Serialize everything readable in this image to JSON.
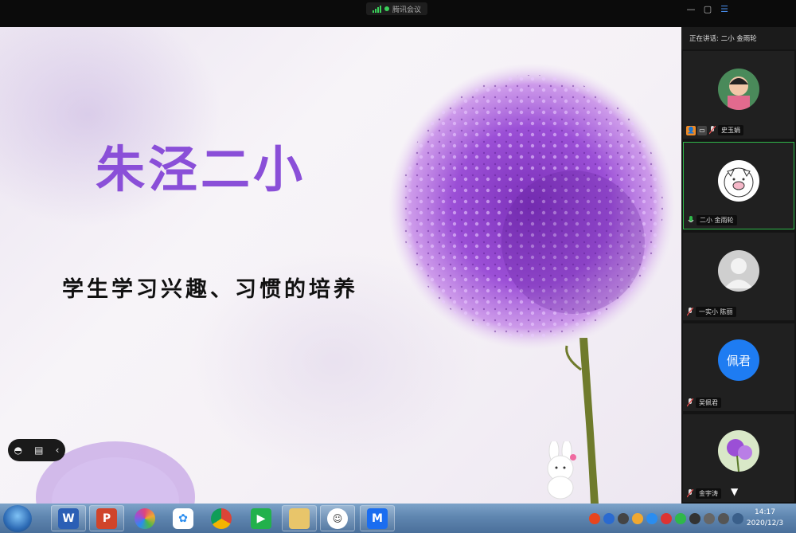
{
  "meeting": {
    "app_name": "腾讯会议"
  },
  "window_controls": [
    {
      "icon": "minimize-icon",
      "glyph": "—"
    },
    {
      "icon": "restore-icon",
      "glyph": "▢"
    },
    {
      "icon": "list-icon",
      "glyph": "☰"
    }
  ],
  "slide": {
    "title": "朱泾二小",
    "subtitle": "学生学习兴趣、习惯的培养",
    "title_color": "#8a4fd8"
  },
  "slide_tools": [
    {
      "icon": "annotation-icon",
      "glyph": "◓"
    },
    {
      "icon": "comment-icon",
      "glyph": "▤"
    },
    {
      "icon": "collapse-chevron-icon",
      "glyph": "‹"
    }
  ],
  "sidebar": {
    "speaking_label": "正在讲话: 二小 金雨轮",
    "participants": [
      {
        "name": "史玉娟",
        "avatar": "photo-child"
      },
      {
        "name": "二小 金雨轮",
        "avatar": "cartoon-pig",
        "active": true
      },
      {
        "name": "一实小 陈丽",
        "avatar": "default-person"
      },
      {
        "name": "吴佩君",
        "avatar": "initials",
        "initials": "佩君",
        "avatar_color": "#1e7cf2"
      },
      {
        "name": "金宇涛",
        "avatar": "photo-flower"
      }
    ]
  },
  "taskbar": {
    "apps": [
      {
        "icon": "word-icon",
        "label": "W",
        "color": "#2b5fb5"
      },
      {
        "icon": "powerpoint-icon",
        "label": "P",
        "color": "#d0442a"
      },
      {
        "icon": "color-wheel-icon",
        "label": "",
        "color": "#e0457b"
      },
      {
        "icon": "cloud-app-icon",
        "label": "",
        "color": "#2a8df0"
      },
      {
        "icon": "chrome-icon",
        "label": "",
        "color": "#e8b21e"
      },
      {
        "icon": "iqiyi-icon",
        "label": "",
        "color": "#22b14c"
      },
      {
        "icon": "folder-icon",
        "label": "",
        "color": "#e8c56a"
      },
      {
        "icon": "meeting-user-icon",
        "label": "",
        "color": "#ffffff"
      },
      {
        "icon": "tencent-meeting-icon",
        "label": "",
        "color": "#1a6df0"
      }
    ],
    "clock": {
      "time": "14:17",
      "date": "2020/12/3"
    }
  }
}
